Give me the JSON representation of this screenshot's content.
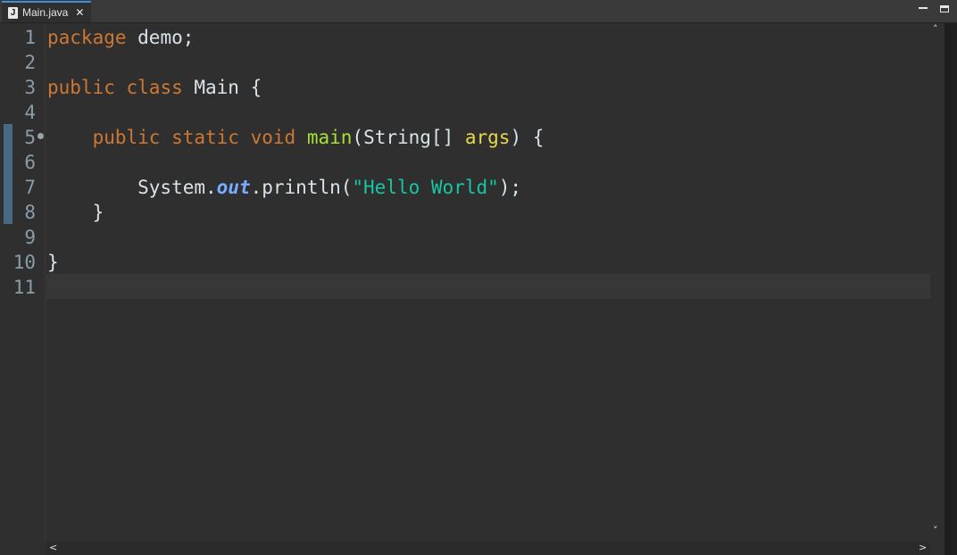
{
  "tab": {
    "file_icon": "J",
    "title": "Main.java",
    "close": "✕",
    "active_accent": "#3f8fd6"
  },
  "window_controls": [
    "minimize-icon",
    "maximize-icon"
  ],
  "editor": {
    "line_numbers": [
      "1",
      "2",
      "3",
      "4",
      "5",
      "6",
      "7",
      "8",
      "9",
      "10",
      "11"
    ],
    "current_line": 11,
    "lines": [
      [
        {
          "t": "kw",
          "v": "package"
        },
        {
          "t": "plain",
          "v": " demo;"
        }
      ],
      [],
      [
        {
          "t": "kw",
          "v": "public"
        },
        {
          "t": "plain",
          "v": " "
        },
        {
          "t": "kw",
          "v": "class"
        },
        {
          "t": "plain",
          "v": " Main {"
        }
      ],
      [],
      [
        {
          "t": "plain",
          "v": "    "
        },
        {
          "t": "kw",
          "v": "public"
        },
        {
          "t": "plain",
          "v": " "
        },
        {
          "t": "kw",
          "v": "static"
        },
        {
          "t": "plain",
          "v": " "
        },
        {
          "t": "kw",
          "v": "void"
        },
        {
          "t": "plain",
          "v": " "
        },
        {
          "t": "method",
          "v": "main"
        },
        {
          "t": "plain",
          "v": "(String[] "
        },
        {
          "t": "param",
          "v": "args"
        },
        {
          "t": "plain",
          "v": ") {"
        }
      ],
      [],
      [
        {
          "t": "plain",
          "v": "        System."
        },
        {
          "t": "field",
          "v": "out"
        },
        {
          "t": "plain",
          "v": ".println("
        },
        {
          "t": "str",
          "v": "\"Hello World\""
        },
        {
          "t": "plain",
          "v": ");"
        }
      ],
      [
        {
          "t": "plain",
          "v": "    }"
        }
      ],
      [],
      [
        {
          "t": "plain",
          "v": "}"
        }
      ],
      []
    ]
  },
  "scrollbars": {
    "up": "˄",
    "down": "˅",
    "left": "<",
    "right": ">"
  }
}
